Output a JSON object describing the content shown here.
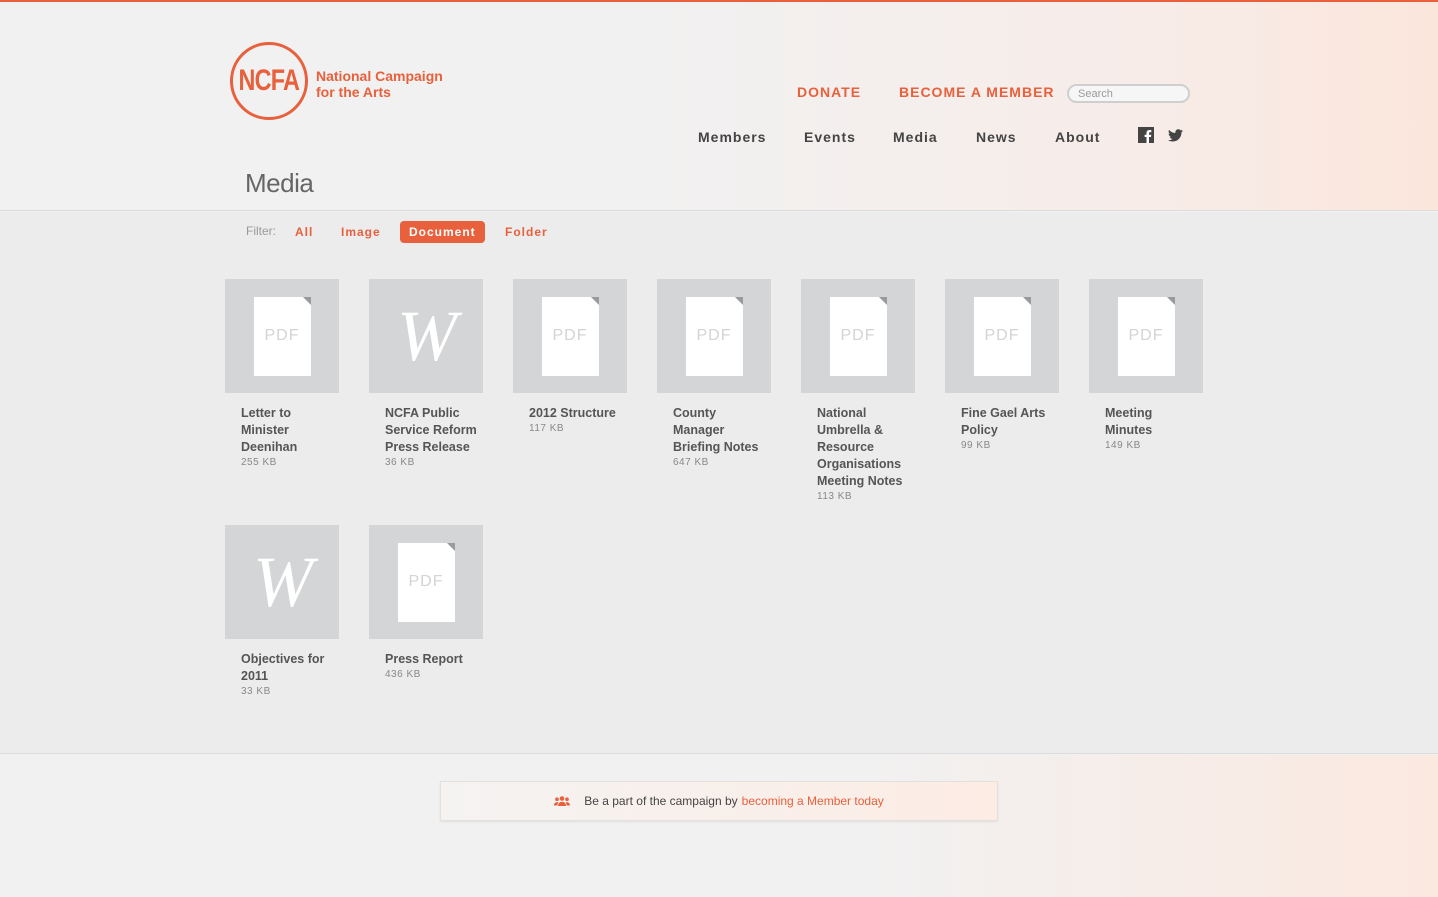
{
  "brand": {
    "logo_mark": "NCFA",
    "name_line1": "National Campaign",
    "name_line2": "for the Arts",
    "accent": "#e8603c"
  },
  "utility": {
    "donate": "DONATE",
    "become_member": "BECOME A MEMBER",
    "search_placeholder": "Search"
  },
  "nav": {
    "items": [
      "Members",
      "Events",
      "Media",
      "News",
      "About"
    ],
    "social": [
      "facebook-icon",
      "twitter-icon"
    ]
  },
  "page": {
    "title": "Media"
  },
  "filter": {
    "label": "Filter:",
    "options": [
      "All",
      "Image",
      "Document",
      "Folder"
    ],
    "active": "Document"
  },
  "documents": [
    {
      "name": "Letter to Minister Deenihan",
      "size": "255 KB",
      "type": "PDF"
    },
    {
      "name": "NCFA Public Service Reform Press Release",
      "size": "36 KB",
      "type": "Word"
    },
    {
      "name": "2012 Structure",
      "size": "117 KB",
      "type": "PDF"
    },
    {
      "name": "County Manager Briefing Notes",
      "size": "647 KB",
      "type": "PDF"
    },
    {
      "name": "National Umbrella & Resource Organisations Meeting Notes",
      "size": "113 KB",
      "type": "PDF"
    },
    {
      "name": "Fine Gael Arts Policy",
      "size": "99 KB",
      "type": "PDF"
    },
    {
      "name": "Meeting Minutes",
      "size": "149 KB",
      "type": "PDF"
    },
    {
      "name": "Objectives for 2011",
      "size": "33 KB",
      "type": "Word"
    },
    {
      "name": "Press Report",
      "size": "436 KB",
      "type": "PDF"
    }
  ],
  "icons": {
    "pdf_label": "PDF",
    "word_label": "W"
  },
  "cta": {
    "text": "Be a part of the campaign by",
    "link": "becoming a Member today",
    "icon": "people-icon"
  }
}
